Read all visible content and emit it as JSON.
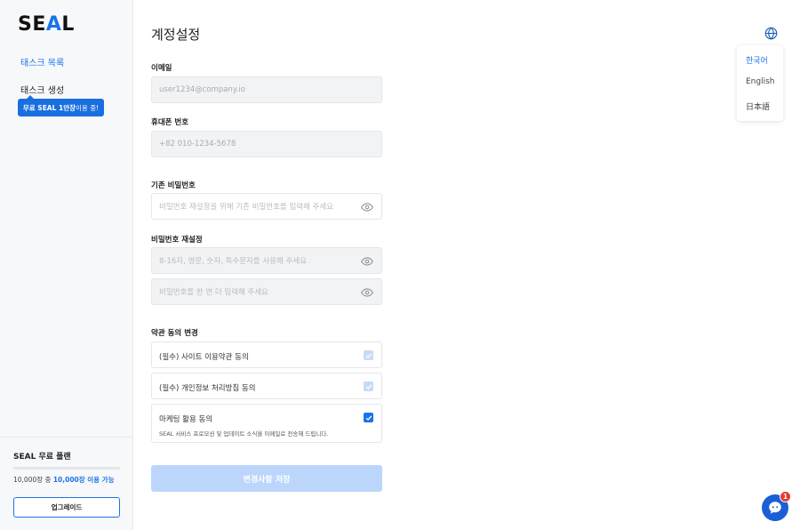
{
  "sidebar": {
    "logo": {
      "pre": "SE",
      "accent": "A",
      "post": "L"
    },
    "nav": [
      {
        "label": "태스크 목록"
      },
      {
        "label": "태스크 생성"
      }
    ],
    "promo": {
      "strong": "무료 SEAL 1만장",
      "rest": " 이용 중!"
    },
    "plan": {
      "name": "SEAL 무료 플랜",
      "usage_prefix": "10,000장 중 ",
      "usage_highlight": "10,000장 이용 가능",
      "used_fraction": 0,
      "upgrade_label": "업그레이드"
    }
  },
  "main": {
    "title": "계정설정",
    "email": {
      "label": "이메일",
      "value": "user1234@company.io"
    },
    "phone": {
      "label": "휴대폰 번호",
      "value": "+82 010-1234-5678"
    },
    "current_password": {
      "label": "기존 비밀번호",
      "placeholder": "비밀번호 재설정을 위해 기존 비밀번호를 입력해 주세요"
    },
    "reset_password": {
      "label": "비밀번호 재설정",
      "new_placeholder": "8-16자, 영문, 숫자, 특수문자를 사용해 주세요",
      "confirm_placeholder": "비밀번호를 한 번 더 입력해 주세요"
    },
    "terms": {
      "label": "약관 동의 변경",
      "items": [
        {
          "text": "(필수) 사이트 이용약관 동의",
          "checked": true,
          "disabled": true
        },
        {
          "text": "(필수) 개인정보 처리방침 동의",
          "checked": true,
          "disabled": true
        },
        {
          "text": "마케팅 활용 동의",
          "sub": "SEAL 서비스 프로모션 및 업데이트 소식을 이메일로 전송해 드립니다.",
          "checked": true,
          "disabled": false
        }
      ]
    },
    "save_label": "변경사항 저장"
  },
  "language": {
    "icon": "globe-icon",
    "options": [
      {
        "label": "한국어",
        "active": true
      },
      {
        "label": "English",
        "active": false
      },
      {
        "label": "日本語",
        "active": false
      }
    ]
  },
  "chat": {
    "icon": "chat-bubble-icon",
    "badge": "1"
  },
  "colors": {
    "accent": "#1a73e8",
    "save_disabled": "#bcd6fb",
    "badge": "#e53935"
  }
}
